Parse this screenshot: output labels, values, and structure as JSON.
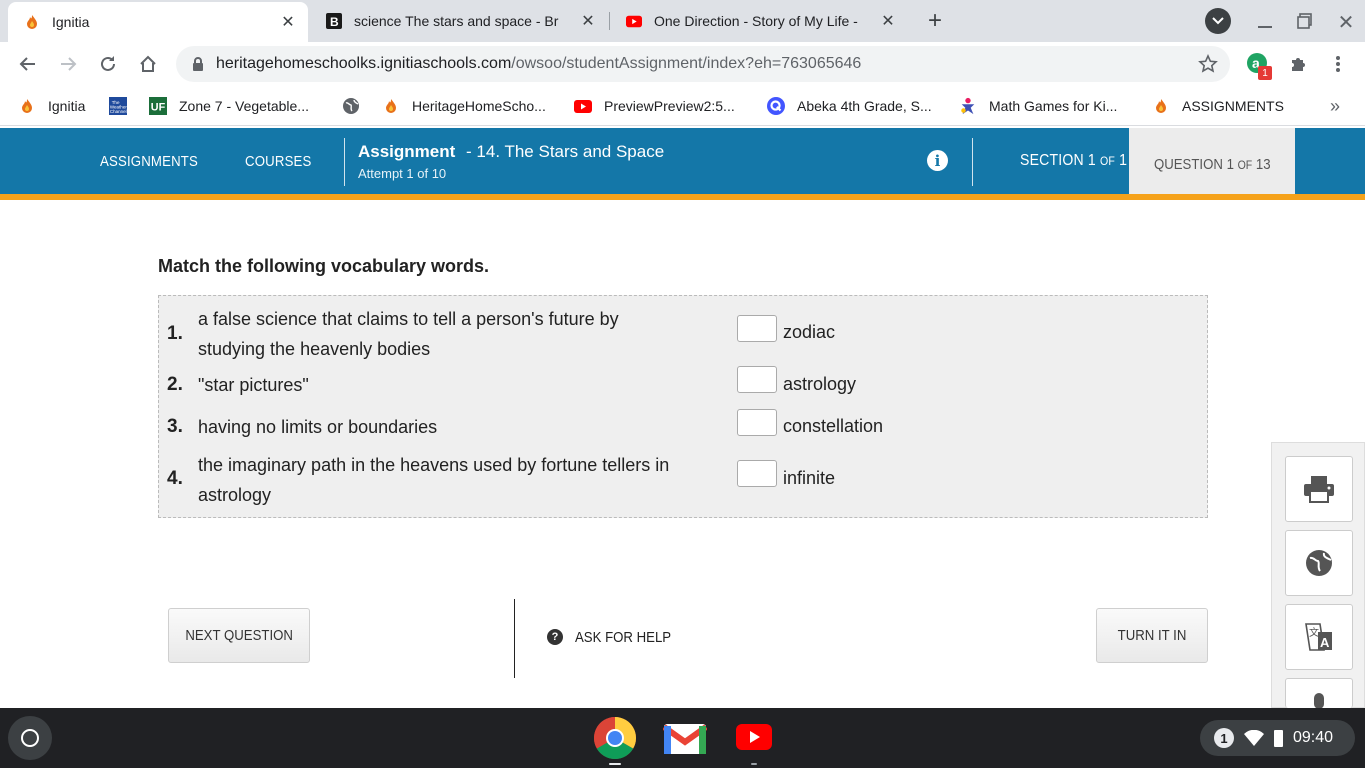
{
  "browser": {
    "tabs": [
      {
        "title": "Ignitia",
        "active": true,
        "icon": "flame-icon"
      },
      {
        "title": "science The stars and space - Br",
        "active": false,
        "icon": "b-logo-icon"
      },
      {
        "title": "One Direction - Story of My Life -",
        "active": false,
        "icon": "youtube-icon"
      }
    ],
    "url_host": "heritagehomeschoolks.ignitiaschools.com",
    "url_path": "/owsoo/studentAssignment/index?eh=763065646",
    "extension_badge": "1",
    "bookmarks": [
      {
        "label": "Ignitia",
        "icon": "flame-icon"
      },
      {
        "label": "",
        "icon": "weather-channel-icon"
      },
      {
        "label": "Zone 7 - Vegetable...",
        "icon": "uf-icon"
      },
      {
        "label": "",
        "icon": "globe-icon"
      },
      {
        "label": "HeritageHomeScho...",
        "icon": "flame-icon"
      },
      {
        "label": "PreviewPreview2:5...",
        "icon": "youtube-icon"
      },
      {
        "label": "Abeka 4th Grade, S...",
        "icon": "quizlet-icon"
      },
      {
        "label": "Math Games for Ki...",
        "icon": "puzzle-person-icon"
      },
      {
        "label": "ASSIGNMENTS",
        "icon": "flame-icon"
      }
    ],
    "bookmarks_overflow": "»"
  },
  "app": {
    "nav": {
      "assignments": "ASSIGNMENTS",
      "courses": "COURSES"
    },
    "assignment_label": "Assignment",
    "assignment_title": "- 14. The Stars and Space",
    "attempt": "Attempt 1 of 10",
    "section": {
      "label": "SECTION",
      "current": "1",
      "of": "OF",
      "total": "1"
    },
    "question": {
      "label": "QUESTION",
      "current": "1",
      "of": "OF",
      "total": "13"
    }
  },
  "question": {
    "prompt": "Match the following vocabulary words.",
    "items": [
      {
        "num": "1.",
        "line1": "a false science that claims to tell a person's future by",
        "line2": "studying the heavenly bodies"
      },
      {
        "num": "2.",
        "line1": "\"star pictures\"",
        "line2": ""
      },
      {
        "num": "3.",
        "line1": "having no limits or boundaries",
        "line2": ""
      },
      {
        "num": "4.",
        "line1": "the imaginary path in the heavens used by fortune tellers in",
        "line2": "astrology"
      }
    ],
    "words": [
      {
        "answer": "",
        "word": "zodiac"
      },
      {
        "answer": "",
        "word": "astrology"
      },
      {
        "answer": "",
        "word": "constellation"
      },
      {
        "answer": "",
        "word": "infinite"
      }
    ]
  },
  "actions": {
    "next": "NEXT QUESTION",
    "help": "ASK FOR HELP",
    "turn_in": "TURN IT IN"
  },
  "tools": [
    "print-icon",
    "globe-icon",
    "translate-icon",
    "microphone-icon"
  ],
  "shelf": {
    "apps": [
      "chrome-icon",
      "gmail-icon",
      "youtube-icon"
    ],
    "notification_count": "1",
    "time": "09:40"
  },
  "colors": {
    "appbar": "#1477a8",
    "accent": "#f5a21a"
  }
}
